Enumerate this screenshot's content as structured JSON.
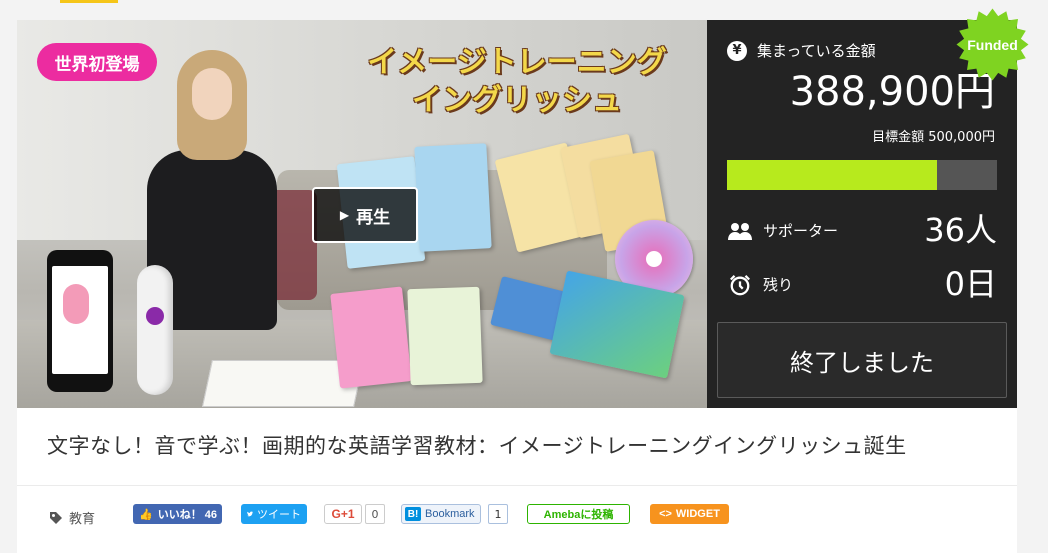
{
  "hero": {
    "badge": "世界初登場",
    "title_line1": "イメージトレーニング",
    "title_line2": "イングリッシュ",
    "play_label": "再生"
  },
  "stats": {
    "funded_label": "集まっている金額",
    "funded_amount": "388,900円",
    "goal_label": "目標金額 500,000円",
    "progress_fraction": 0.778,
    "supporters_label": "サポーター",
    "supporters_value": "36人",
    "remaining_label": "残り",
    "remaining_value": "0日",
    "ended_button": "終了しました",
    "status_badge": "Funded",
    "colors": {
      "accent": "#b7ea1d",
      "panel": "#232323",
      "badge": "#7fd321"
    }
  },
  "project": {
    "title": "文字なし！音で学ぶ！画期的な英語学習教材：イメージトレーニングイングリッシュ誕生"
  },
  "share": {
    "category_label": "教育",
    "facebook_label": "いいね！ 46",
    "twitter_label": "ツイート",
    "gplus_label": "G+1",
    "gplus_count": "0",
    "hatena_label": "Bookmark",
    "hatena_count": "1",
    "ameba_label": "Amebaに投稿",
    "widget_label": "WIDGET"
  }
}
